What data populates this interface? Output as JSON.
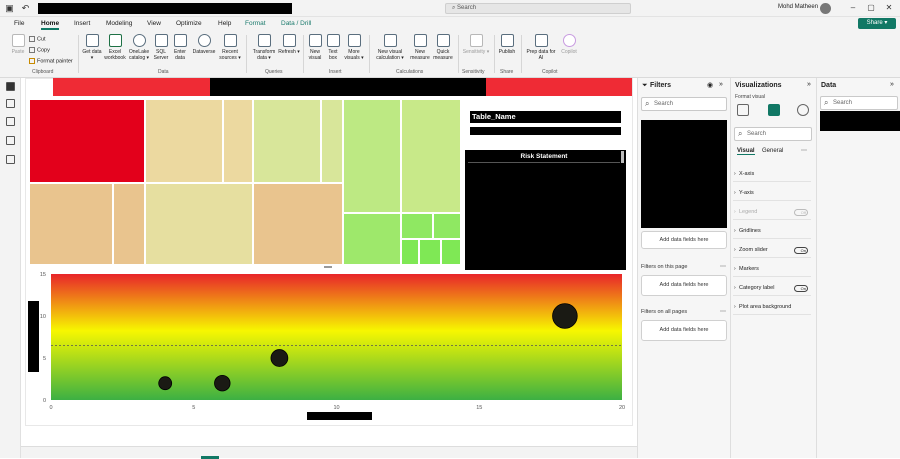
{
  "titlebar": {
    "search_placeholder": "Search",
    "user_name": "Mohd Matheen",
    "win_buttons": [
      "–",
      "▢",
      "✕"
    ]
  },
  "menu": {
    "items": [
      "File",
      "Home",
      "Insert",
      "Modeling",
      "View",
      "Optimize",
      "Help",
      "Format",
      "Data / Drill"
    ],
    "active": "Home",
    "share_label": "Share ▾"
  },
  "ribbon": {
    "clipboard": {
      "paste": "Paste",
      "cut": "Cut",
      "copy": "Copy",
      "format_painter": "Format painter",
      "group": "Clipboard"
    },
    "data": {
      "get_data": "Get data ▾",
      "excel": "Excel workbook",
      "onelake": "OneLake catalog ▾",
      "sql": "SQL Server",
      "enter": "Enter data",
      "dataverse": "Dataverse",
      "recent": "Recent sources ▾",
      "group": "Data"
    },
    "queries": {
      "transform": "Transform data ▾",
      "refresh": "Refresh ▾",
      "group": "Queries"
    },
    "insert": {
      "new_visual": "New visual",
      "text_box": "Text box",
      "more_visuals": "More visuals ▾",
      "group": "Insert"
    },
    "calculations": {
      "new_visual_calc": "New visual calculation ▾",
      "new_measure": "New measure",
      "quick_measure": "Quick measure",
      "group": "Calculations"
    },
    "sensitivity": {
      "label": "Sensitivity ▾",
      "group": "Sensitivity"
    },
    "share": {
      "publish": "Publish",
      "group": "Share"
    },
    "copilot": {
      "prep": "Prep data for AI",
      "copilot": "Copilot",
      "group": "Copilot"
    }
  },
  "report": {
    "table_name_label": "Table_Name",
    "risk_statement_label": "Risk Statement"
  },
  "chart_data": {
    "type": "scatter",
    "xlim": [
      0,
      20
    ],
    "ylim": [
      0,
      15
    ],
    "x_ticks": [
      "0",
      "5",
      "10",
      "15",
      "20"
    ],
    "y_ticks": [
      "0",
      "5",
      "10",
      "15"
    ],
    "reference_line_y": 6.5,
    "points": [
      {
        "x": 4,
        "y": 2,
        "size": 1
      },
      {
        "x": 6,
        "y": 2,
        "size": 1.2
      },
      {
        "x": 8,
        "y": 5,
        "size": 1.3
      },
      {
        "x": 18,
        "y": 10,
        "size": 1.9
      }
    ],
    "background_gradient": [
      "#e8252a",
      "#f7f700",
      "#3cb043"
    ],
    "grid": false
  },
  "treemap": {
    "colors": {
      "red": "#e3001b",
      "sand": "#ecd9a0",
      "tan": "#e9c48e",
      "pale_green": "#d8e69a",
      "light_green": "#bde983",
      "green": "#9ee86b",
      "bright_green": "#7fe855"
    }
  },
  "filters": {
    "title": "Filters",
    "search_placeholder": "Search",
    "add_fields": "Add data fields here",
    "on_this_page": "Filters on this page",
    "on_all_pages": "Filters on all pages"
  },
  "visualizations": {
    "title": "Visualizations",
    "format_visual": "Format visual",
    "search_placeholder": "Search",
    "tabs": [
      "Visual",
      "General"
    ],
    "rows": [
      {
        "label": "X-axis",
        "toggle": ""
      },
      {
        "label": "Y-axis",
        "toggle": ""
      },
      {
        "label": "Legend",
        "toggle": "Off"
      },
      {
        "label": "Gridlines",
        "toggle": ""
      },
      {
        "label": "Zoom slider",
        "toggle": "On"
      },
      {
        "label": "Markers",
        "toggle": ""
      },
      {
        "label": "Category label",
        "toggle": "On"
      },
      {
        "label": "Plot area background",
        "toggle": ""
      }
    ]
  },
  "data_pane": {
    "title": "Data",
    "search_placeholder": "Search"
  }
}
